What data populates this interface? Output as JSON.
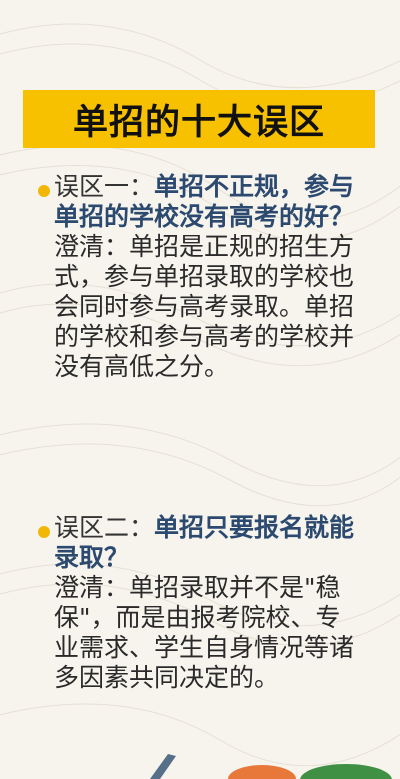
{
  "banner": {
    "title": "单招的十大误区"
  },
  "sections": [
    {
      "label": "误区一：",
      "question": "单招不正规，参与单招的学校没有高考的好？",
      "answer": "澄清：单招是正规的招生方式，参与单招录取的学校也会同时参与高考录取。单招的学校和参与高考的学校并没有高低之分。"
    },
    {
      "label": "误区二：",
      "question": "单招只要报名就能录取？",
      "answer": "澄清：单招录取并不是\"稳保\"，而是由报考院校、专业需求、学生自身情况等诸多因素共同决定的。"
    }
  ],
  "colors": {
    "banner": "#f7c100",
    "bullet": "#f2b705",
    "question": "#2c4a70",
    "background": "#f7f4ee"
  }
}
